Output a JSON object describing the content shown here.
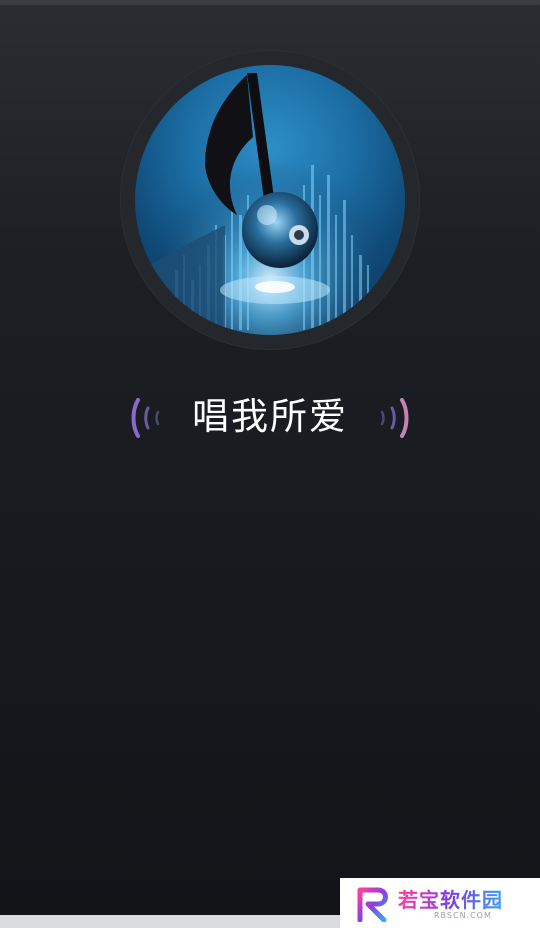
{
  "player": {
    "song_title": "唱我所爱"
  },
  "album_art": {
    "icon": "music-note-icon"
  },
  "watermark": {
    "name": "若宝软件园",
    "url": "RBSCN.COM"
  },
  "colors": {
    "background": "#16191e",
    "ring": "#24272c",
    "art_blue": "#1c6fa6",
    "title": "#ffffff",
    "wave_purple": "#8a6ad0",
    "wave_pink": "#c880b8"
  }
}
